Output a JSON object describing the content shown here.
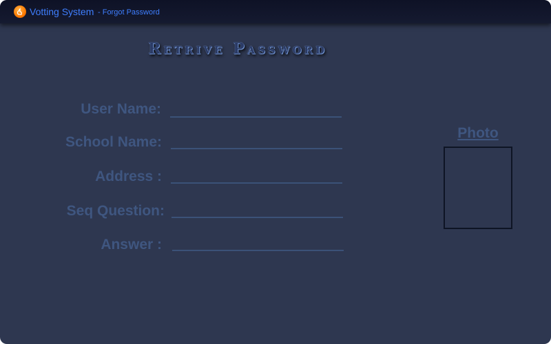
{
  "window": {
    "app_name": "Votting System",
    "subtitle": "- Forgot Password",
    "icon": "app-logo-icon"
  },
  "page": {
    "title": "Retrive Password"
  },
  "form": {
    "user_name_label": "User Name:",
    "user_name_value": "",
    "school_name_label": "School Name:",
    "school_name_value": "",
    "address_label": "Address :",
    "address_value": "",
    "seq_question_label": "Seq Question:",
    "seq_question_value": "",
    "answer_label": "Answer :",
    "answer_value": ""
  },
  "photo": {
    "label": "Photo"
  },
  "colors": {
    "background": "#2e3750",
    "titlebar": "#11152b",
    "label_text": "#3f5680",
    "title_accent": "#3f7fff",
    "icon_orange": "#ff7a00"
  }
}
